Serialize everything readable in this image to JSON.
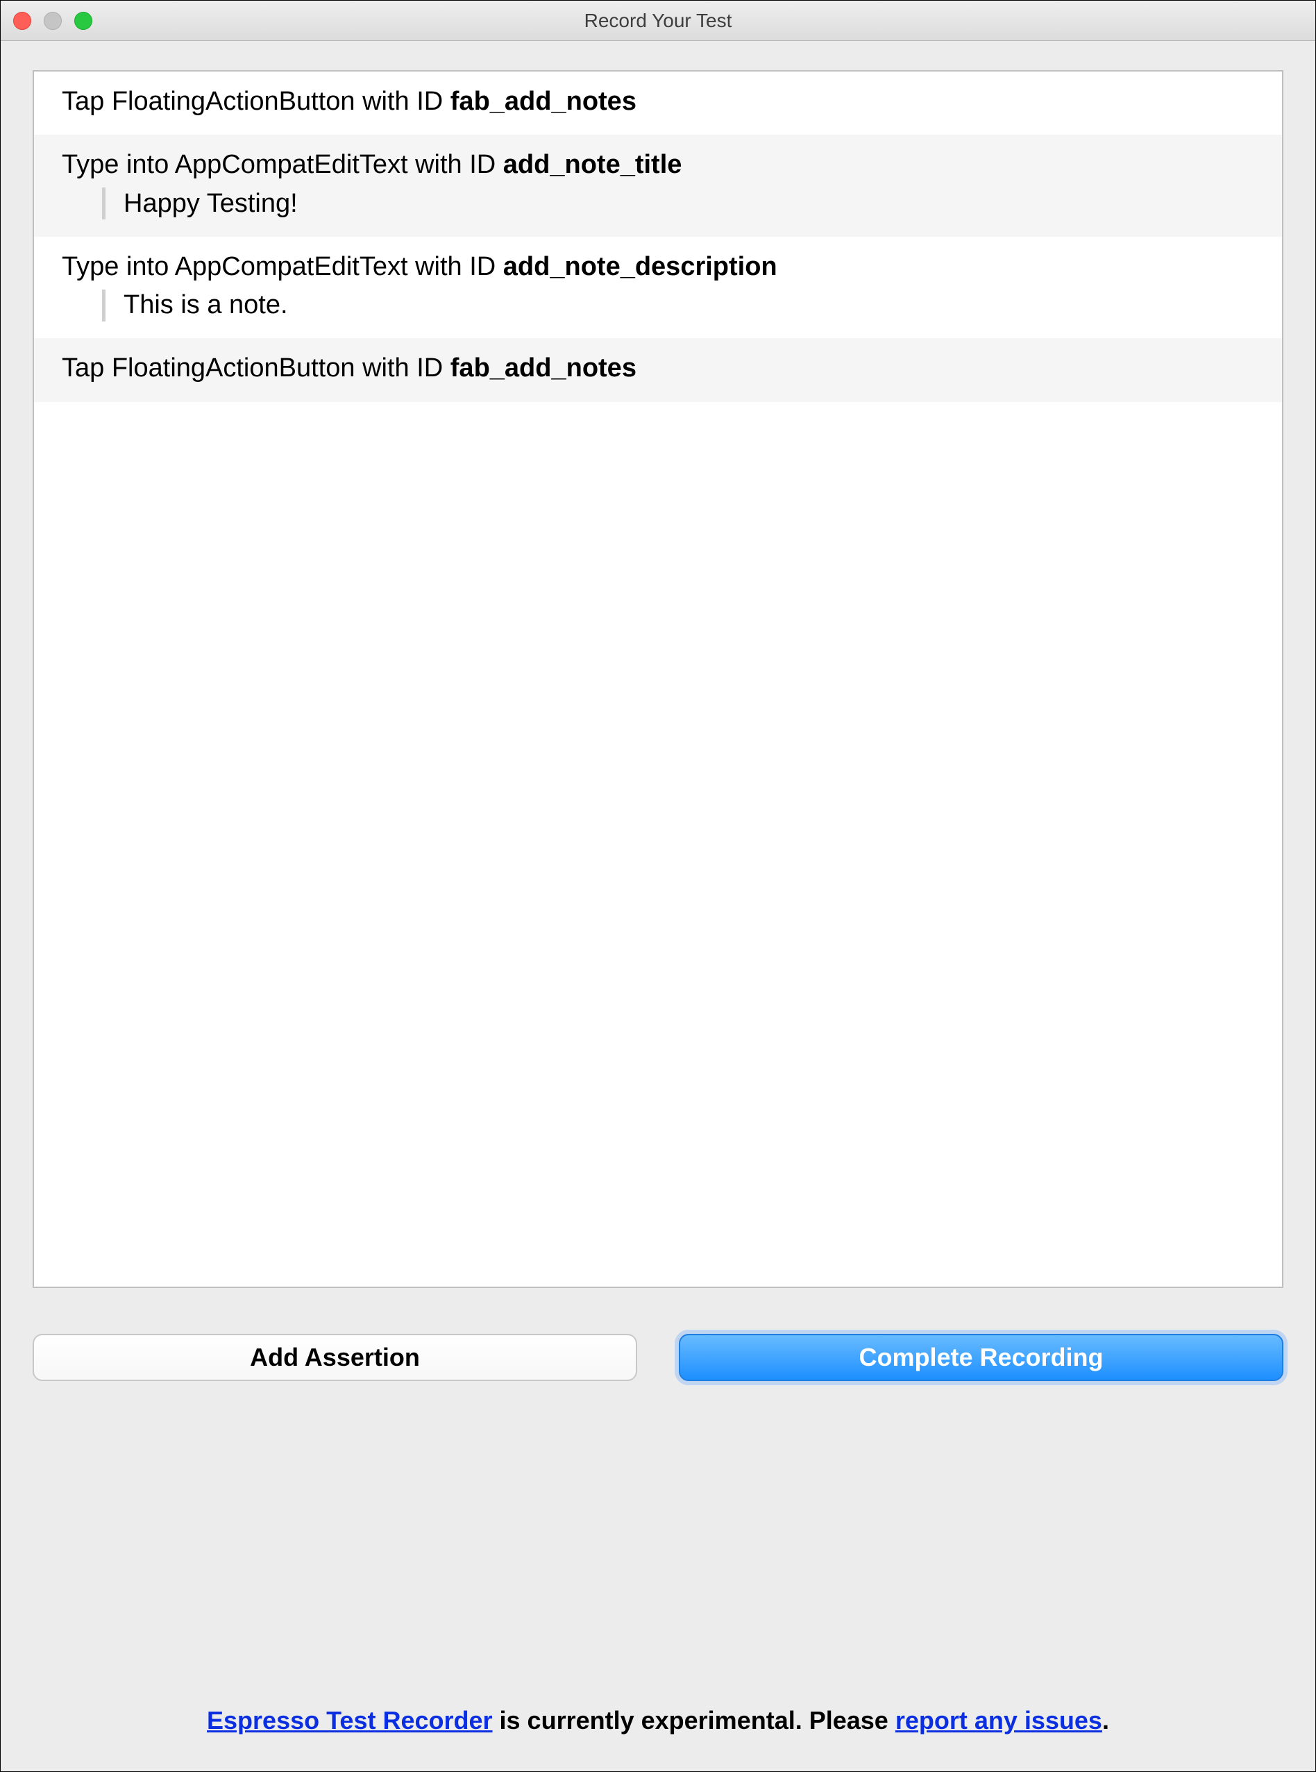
{
  "window": {
    "title": "Record Your Test"
  },
  "entries": [
    {
      "action": "Tap",
      "widget": "FloatingActionButton",
      "id": "fab_add_notes",
      "value": null
    },
    {
      "action": "Type into",
      "widget": "AppCompatEditText",
      "id": "add_note_title",
      "value": "Happy Testing!"
    },
    {
      "action": "Type into",
      "widget": "AppCompatEditText",
      "id": "add_note_description",
      "value": "This is a note."
    },
    {
      "action": "Tap",
      "widget": "FloatingActionButton",
      "id": "fab_add_notes",
      "value": null
    }
  ],
  "buttons": {
    "add_assertion": "Add Assertion",
    "complete_recording": "Complete Recording"
  },
  "footer": {
    "link1": "Espresso Test Recorder",
    "middle": " is currently experimental. Please ",
    "link2": "report any issues",
    "end": "."
  }
}
